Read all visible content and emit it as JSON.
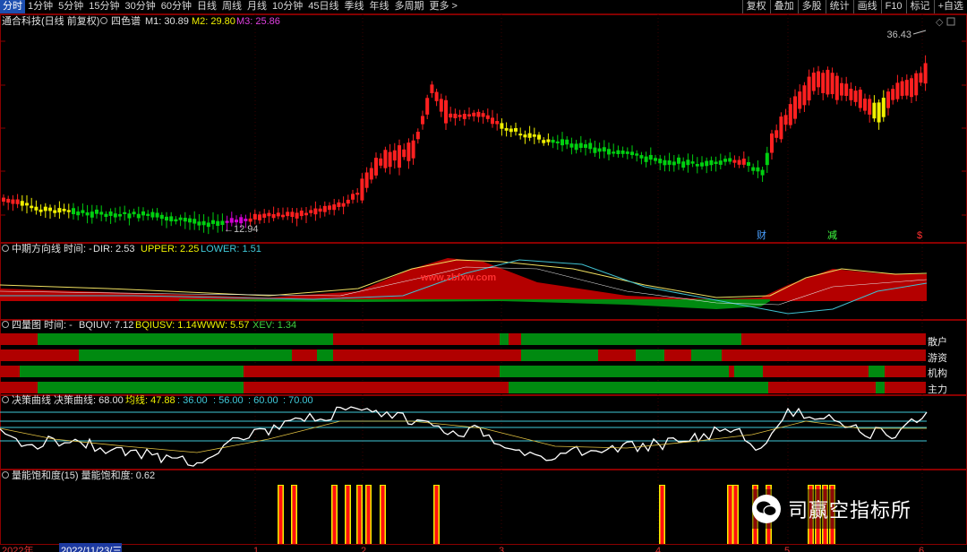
{
  "toolbar": {
    "left": [
      "分时",
      "1分钟",
      "5分钟",
      "15分钟",
      "30分钟",
      "60分钟",
      "日线",
      "周线",
      "月线",
      "10分钟",
      "45日线",
      "季线",
      "年线",
      "多周期",
      "更多 >"
    ],
    "right": [
      "复权",
      "叠加",
      "多股",
      "统计",
      "画线",
      "F10",
      "标记",
      "+自选"
    ],
    "active_index": 0
  },
  "main_panel": {
    "title": "通合科技(日线 前复权)",
    "indicator": "四色谱",
    "m1": "M1: 30.89",
    "m2": "M2: 29.80",
    "m3": "M3: 25.86",
    "high_label": "36.43",
    "low_label": "12.94",
    "markers": [
      "财",
      "减",
      "$"
    ]
  },
  "panel2": {
    "name": "中期方向线",
    "time": "时间: -",
    "dir": "DIR: 2.53",
    "upper": "UPPER: 2.25",
    "lower": "LOWER: 1.51",
    "watermark": "www.zbfxw.com"
  },
  "panel3": {
    "name": "四量图",
    "time": "时间: -",
    "bqiuv": "BQIUV: 7.12",
    "bqiusv": "BQIUSV: 1.14",
    "www": "WWW: 5.57",
    "xev": "XEV: 1.34",
    "rows": [
      "散户",
      "游资",
      "机构",
      "主力"
    ]
  },
  "panel4": {
    "name": "决策曲线",
    "curve": "决策曲线: 68.00",
    "avg": "均线: 47.88",
    "l1": ": 36.00",
    "l2": ": 56.00",
    "l3": ": 60.00",
    "l4": ": 70.00"
  },
  "panel5": {
    "name": "量能饱和度(15)",
    "value": "量能饱和度: 0.62"
  },
  "dates": [
    "2022年",
    "2022/11/23/三",
    "1",
    "2",
    "3",
    "4",
    "5",
    "6"
  ],
  "logo": {
    "text": "司赢空指标所"
  },
  "colors": {
    "up": "#ff2020",
    "down": "#00d010",
    "yellow": "#f0f000",
    "magenta": "#d000d0",
    "cyan": "#40d0e0",
    "panelborder": "#8a0000"
  }
}
